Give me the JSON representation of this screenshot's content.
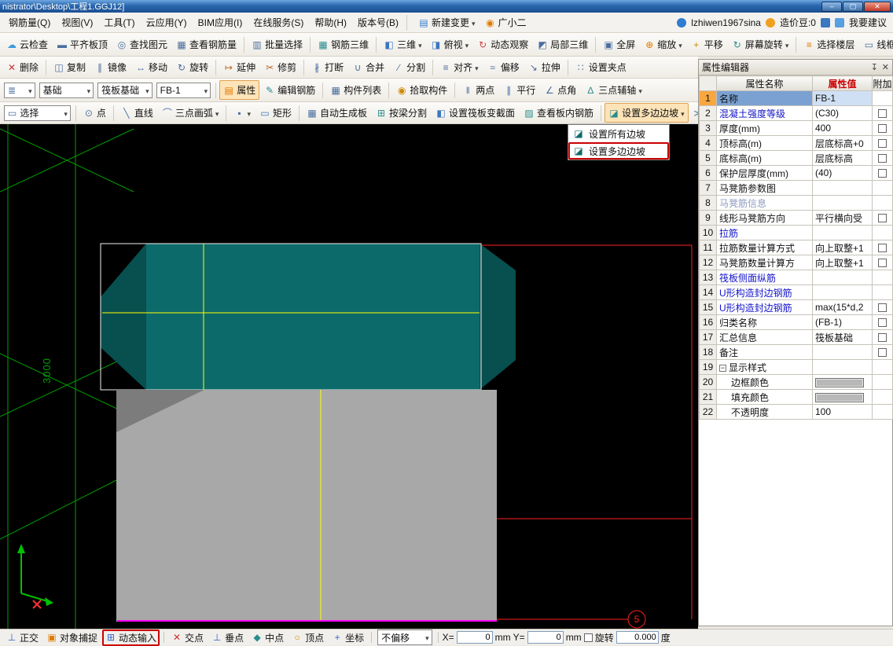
{
  "colors": {
    "canvas_bg": "#000000",
    "grid_green": "#00a000",
    "slab_teal": "#0c6a6a",
    "slab_teal_dark": "#084f4f",
    "slab_gray": "#a8a8a8",
    "slab_gray_dark": "#7c7c7c",
    "selection_yellow": "#ffff00",
    "outline_white": "#f0f0f0",
    "plan_red": "#ff2020",
    "base_magenta": "#ff00ff",
    "annotation_red": "#cc0000",
    "ucs_green": "#00c000",
    "ucs_red": "#ff3030",
    "value_header_red": "#cc0000"
  },
  "titlebar": {
    "title": "nistrator\\Desktop\\工程1.GGJ12]",
    "minimize_label": "–",
    "maximize_label": "▢",
    "close_label": "✕"
  },
  "menubar": {
    "items": [
      {
        "name": "menu-rebar-quantity",
        "label": "钢筋量(Q)"
      },
      {
        "name": "menu-view",
        "label": "视图(V)"
      },
      {
        "name": "menu-tools",
        "label": "工具(T)"
      },
      {
        "name": "menu-cloud-app",
        "label": "云应用(Y)"
      },
      {
        "name": "menu-bim-app",
        "label": "BIM应用(I)"
      },
      {
        "name": "menu-online-service",
        "label": "在线服务(S)"
      },
      {
        "name": "menu-help",
        "label": "帮助(H)"
      },
      {
        "name": "menu-version",
        "label": "版本号(B)"
      }
    ],
    "actions": [
      {
        "name": "new-change-order-button",
        "icon": "▤",
        "label": "新建变更",
        "arrow": true,
        "color": "#2f7cd0"
      },
      {
        "name": "guangxiaoer-button",
        "icon": "◉",
        "label": "广小二",
        "color": "#e07b00"
      }
    ],
    "user_label": "lzhiwen1967sina",
    "coins_label": "造价豆:0",
    "suggest_label": "我要建议"
  },
  "toolbars": {
    "view": [
      {
        "name": "cloud-check-button",
        "icon": "☁",
        "label": "云检查",
        "color": "#3a9ad9"
      },
      {
        "name": "align-slab-top-button",
        "icon": "▬",
        "label": "平齐板顶"
      },
      {
        "name": "find-element-button",
        "icon": "◎",
        "label": "查找图元"
      },
      {
        "name": "view-rebar-quantity-button",
        "icon": "▦",
        "label": "查看钢筋量"
      },
      {
        "type": "sep"
      },
      {
        "name": "batch-select-button",
        "icon": "▥",
        "label": "批量选择"
      },
      {
        "type": "sep"
      },
      {
        "name": "rebar-3d-button",
        "icon": "▦",
        "label": "钢筋三维",
        "color": "#2a8c8c"
      },
      {
        "type": "sep"
      },
      {
        "name": "view-3d-dropdown",
        "icon": "◧",
        "label": "三维",
        "arrow": true,
        "color": "#3a78c0"
      },
      {
        "name": "top-view-dropdown",
        "icon": "◨",
        "label": "俯视",
        "arrow": true,
        "color": "#3a78c0"
      },
      {
        "name": "orbit-button",
        "icon": "↻",
        "label": "动态观察",
        "color": "#cc4444"
      },
      {
        "name": "partial-3d-button",
        "icon": "◩",
        "label": "局部三维"
      },
      {
        "type": "sep"
      },
      {
        "name": "fullscreen-button",
        "icon": "▣",
        "label": "全屏"
      },
      {
        "name": "zoom-dropdown",
        "icon": "⊕",
        "label": "缩放",
        "arrow": true,
        "color": "#e07b00"
      },
      {
        "name": "pan-button",
        "icon": "+",
        "label": "平移",
        "color": "#cc8800"
      },
      {
        "name": "screen-rotate-dropdown",
        "icon": "↻",
        "label": "屏幕旋转",
        "arrow": true,
        "color": "#2a8c8c"
      },
      {
        "type": "sep"
      },
      {
        "name": "select-floor-button",
        "icon": "≡",
        "label": "选择楼层",
        "color": "#e07b00"
      },
      {
        "name": "wireframe-button",
        "icon": "▭",
        "label": "线框"
      }
    ],
    "edit": [
      {
        "name": "delete-button",
        "icon": "✕",
        "label": "删除",
        "color": "#cc3333"
      },
      {
        "type": "sep"
      },
      {
        "name": "copy-button",
        "icon": "◫",
        "label": "复制"
      },
      {
        "name": "mirror-button",
        "icon": "∥",
        "label": "镜像"
      },
      {
        "name": "move-button",
        "icon": "↔",
        "label": "移动"
      },
      {
        "name": "rotate-button",
        "icon": "↻",
        "label": "旋转"
      },
      {
        "type": "sep"
      },
      {
        "name": "extend-button",
        "icon": "↦",
        "label": "延伸",
        "color": "#b86a2c"
      },
      {
        "name": "trim-button",
        "icon": "✂",
        "label": "修剪",
        "color": "#b86a2c"
      },
      {
        "type": "sep"
      },
      {
        "name": "break-button",
        "icon": "∦",
        "label": "打断"
      },
      {
        "name": "join-button",
        "icon": "∪",
        "label": "合并"
      },
      {
        "name": "split-button",
        "icon": "∕",
        "label": "分割"
      },
      {
        "type": "sep"
      },
      {
        "name": "align-dropdown",
        "icon": "≡",
        "label": "对齐",
        "arrow": true
      },
      {
        "name": "offset-button",
        "icon": "≈",
        "label": "偏移"
      },
      {
        "name": "stretch-button",
        "icon": "↘",
        "label": "拉伸"
      },
      {
        "type": "sep"
      },
      {
        "name": "set-grip-button",
        "icon": "∷",
        "label": "设置夹点"
      }
    ],
    "component": [
      {
        "type": "combo",
        "name": "floor-combo",
        "icon": "≣",
        "label": ""
      },
      {
        "type": "combo",
        "name": "category-combo",
        "label": "基础"
      },
      {
        "type": "combo",
        "name": "element-type-combo",
        "label": "筏板基础"
      },
      {
        "type": "combo",
        "name": "element-combo",
        "label": "FB-1"
      },
      {
        "type": "sep"
      },
      {
        "name": "properties-button",
        "icon": "▤",
        "label": "属性",
        "color": "#e07b00",
        "pressed": true
      },
      {
        "name": "edit-rebar-button",
        "icon": "✎",
        "label": "编辑钢筋",
        "color": "#2a8c8c"
      },
      {
        "type": "sep"
      },
      {
        "name": "component-list-button",
        "icon": "▦",
        "label": "构件列表"
      },
      {
        "type": "sep"
      },
      {
        "name": "pick-component-button",
        "icon": "◉",
        "label": "拾取构件",
        "color": "#cc8800"
      },
      {
        "type": "sep"
      },
      {
        "name": "two-point-axis-button",
        "icon": "‖",
        "label": "两点"
      },
      {
        "name": "parallel-axis-button",
        "icon": "∥",
        "label": "平行"
      },
      {
        "name": "point-angle-axis-button",
        "icon": "∠",
        "label": "点角"
      },
      {
        "name": "three-point-aux-axis-dropdown",
        "icon": "∆",
        "label": "三点辅轴",
        "arrow": true,
        "color": "#2a8c8c"
      }
    ],
    "draw": [
      {
        "type": "combo",
        "name": "select-combo",
        "icon": "▭",
        "label": "选择"
      },
      {
        "type": "sep"
      },
      {
        "name": "point-button",
        "icon": "⊙",
        "label": "点"
      },
      {
        "type": "sep"
      },
      {
        "name": "line-button",
        "icon": "╲",
        "label": "直线"
      },
      {
        "name": "arc-3pt-dropdown",
        "icon": "⌒",
        "label": "三点画弧",
        "arrow": true
      },
      {
        "type": "sep"
      },
      {
        "name": "shape-more-dropdown",
        "icon": "▪",
        "label": "",
        "arrow": true
      },
      {
        "name": "rectangle-button",
        "icon": "▭",
        "label": "矩形",
        "color": "#3a78c0"
      },
      {
        "type": "sep"
      },
      {
        "name": "auto-generate-slab-button",
        "icon": "▦",
        "label": "自动生成板"
      },
      {
        "name": "split-by-beam-button",
        "icon": "⊞",
        "label": "按梁分割",
        "color": "#2a8c8c"
      },
      {
        "name": "set-raft-section-button",
        "icon": "◧",
        "label": "设置筏板变截面",
        "color": "#3a78c0"
      },
      {
        "name": "view-slab-rebar-button",
        "icon": "▨",
        "label": "查看板内钢筋",
        "color": "#2a8c8c"
      },
      {
        "type": "sep"
      },
      {
        "name": "set-edge-slope-dropdown",
        "icon": "◪",
        "label": "设置多边边坡",
        "arrow": true,
        "pressed": true,
        "color": "#2a8c8c"
      },
      {
        "name": "toolbar-overflow-button",
        "icon": "≫",
        "label": ""
      }
    ]
  },
  "slope_menu": {
    "items": [
      {
        "name": "set-all-edge-slopes-item",
        "icon": "◪",
        "label": "设置所有边坡"
      },
      {
        "name": "set-multi-edge-slopes-item",
        "icon": "◪",
        "label": "设置多边边坡",
        "annotated": true
      }
    ]
  },
  "property_editor": {
    "title": "属性编辑器",
    "col_name": "属性名称",
    "col_value": "属性值",
    "col_extra": "附加",
    "rows": [
      {
        "num": "1",
        "name_text": "名称",
        "value": "FB-1",
        "style": "selected"
      },
      {
        "num": "2",
        "name_text": "混凝土强度等级",
        "value": "(C30)",
        "link": true,
        "checkbox": true
      },
      {
        "num": "3",
        "name_text": "厚度(mm)",
        "value": "400",
        "checkbox": true
      },
      {
        "num": "4",
        "name_text": "顶标高(m)",
        "value": "层底标高+0",
        "checkbox": true
      },
      {
        "num": "5",
        "name_text": "底标高(m)",
        "value": "层底标高",
        "checkbox": true
      },
      {
        "num": "6",
        "name_text": "保护层厚度(mm)",
        "value": "(40)",
        "checkbox": true
      },
      {
        "num": "7",
        "name_text": "马凳筋参数图",
        "value": ""
      },
      {
        "num": "8",
        "name_text": "马凳筋信息",
        "value": "",
        "muted": true
      },
      {
        "num": "9",
        "name_text": "线形马凳筋方向",
        "value": "平行横向受",
        "checkbox": true
      },
      {
        "num": "10",
        "name_text": "拉筋",
        "value": "",
        "link": true
      },
      {
        "num": "11",
        "name_text": "拉筋数量计算方式",
        "value": "向上取整+1",
        "checkbox": true
      },
      {
        "num": "12",
        "name_text": "马凳筋数量计算方",
        "value": "向上取整+1",
        "checkbox": true
      },
      {
        "num": "13",
        "name_text": "筏板侧面纵筋",
        "value": "",
        "link": true
      },
      {
        "num": "14",
        "name_text": "U形构造封边钢筋",
        "value": "",
        "link": true
      },
      {
        "num": "15",
        "name_text": "U形构造封边钢筋",
        "value": "max(15*d,2",
        "link": true,
        "checkbox": true
      },
      {
        "num": "16",
        "name_text": "归类名称",
        "value": "(FB-1)",
        "checkbox": true
      },
      {
        "num": "17",
        "name_text": "汇总信息",
        "value": "筏板基础",
        "checkbox": true
      },
      {
        "num": "18",
        "name_text": "备注",
        "value": "",
        "checkbox": true
      },
      {
        "num": "19",
        "name_text": "显示样式",
        "value": "",
        "expander": true
      },
      {
        "num": "20",
        "name_text": "边框颜色",
        "swatch": "#b8b8b8",
        "indent": true
      },
      {
        "num": "21",
        "name_text": "填充颜色",
        "swatch": "#b8b8b8",
        "indent": true
      },
      {
        "num": "22",
        "name_text": "不透明度",
        "value": "100",
        "indent": true
      }
    ]
  },
  "statusbar": {
    "toggles": [
      {
        "name": "ortho-toggle",
        "icon": "⊥",
        "label": "正交",
        "color": "#3366cc"
      },
      {
        "name": "object-snap-toggle",
        "icon": "▣",
        "label": "对象捕捉",
        "color": "#e07b00"
      },
      {
        "name": "dynamic-input-toggle",
        "icon": "⊞",
        "label": "动态输入",
        "color": "#3366cc",
        "annotated": true
      }
    ],
    "snaps": [
      {
        "name": "intersection-snap-toggle",
        "icon": "✕",
        "label": "交点",
        "color": "#cc3333"
      },
      {
        "name": "perpendicular-snap-toggle",
        "icon": "⊥",
        "label": "垂点",
        "color": "#3366cc"
      },
      {
        "name": "midpoint-snap-toggle",
        "icon": "◆",
        "label": "中点",
        "color": "#2a8c8c"
      },
      {
        "name": "vertex-snap-toggle",
        "icon": "○",
        "label": "顶点",
        "color": "#cc8800"
      },
      {
        "name": "coordinate-snap-toggle",
        "icon": "+",
        "label": "坐标",
        "color": "#3366cc"
      }
    ],
    "offset_value": "不偏移",
    "x_label": "X=",
    "x_value": "0",
    "x_unit": "mm",
    "y_label": "Y=",
    "y_value": "0",
    "y_unit": "mm",
    "rotate_label": "旋转",
    "rotate_value": "0.000",
    "rotate_unit": "度"
  },
  "canvas": {
    "dimension_label": "3000",
    "axis_bubble_label": "5"
  }
}
